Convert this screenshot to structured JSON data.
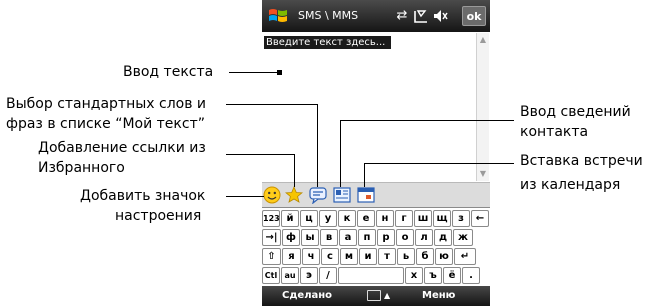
{
  "screen": {
    "title": "SMS \\ MMS",
    "ok_label": "ok",
    "text_placeholder": "Введите текст здесь...",
    "softkeys": {
      "left": "Сделано",
      "right": "Меню"
    },
    "toolbar_icons": [
      "emoticon-icon",
      "favorites-star-icon",
      "my-text-icon",
      "contact-card-icon",
      "calendar-icon"
    ],
    "status_icons": [
      "connectivity-icon",
      "signal-icon",
      "volume-icon"
    ]
  },
  "keyboard": {
    "rows": [
      [
        "123",
        "й",
        "ц",
        "у",
        "к",
        "е",
        "н",
        "г",
        "ш",
        "щ",
        "з",
        "←"
      ],
      [
        "→|",
        "ф",
        "ы",
        "в",
        "а",
        "п",
        "р",
        "о",
        "л",
        "д",
        "ж"
      ],
      [
        "⇧",
        "я",
        "ч",
        "с",
        "м",
        "и",
        "т",
        "ь",
        "б",
        "ю",
        "↵"
      ],
      [
        "Ctl",
        "au",
        "э",
        "/",
        "",
        "х",
        "ъ",
        "ё",
        "."
      ]
    ]
  },
  "callouts": {
    "text_input": "Ввод текста",
    "my_text_line1": "Выбор стандартных слов и",
    "my_text_line2": "фраз в списке “Мой текст”",
    "favorites_line1": "Добавление ссылки из",
    "favorites_line2": "Избранного",
    "emoticon_line1": "Добавить значок",
    "emoticon_line2": "настроения",
    "contact_line1": "Ввод сведений",
    "contact_line2": "контакта",
    "calendar_line1": "Вставка встречи",
    "calendar_line2": "из календаря"
  }
}
